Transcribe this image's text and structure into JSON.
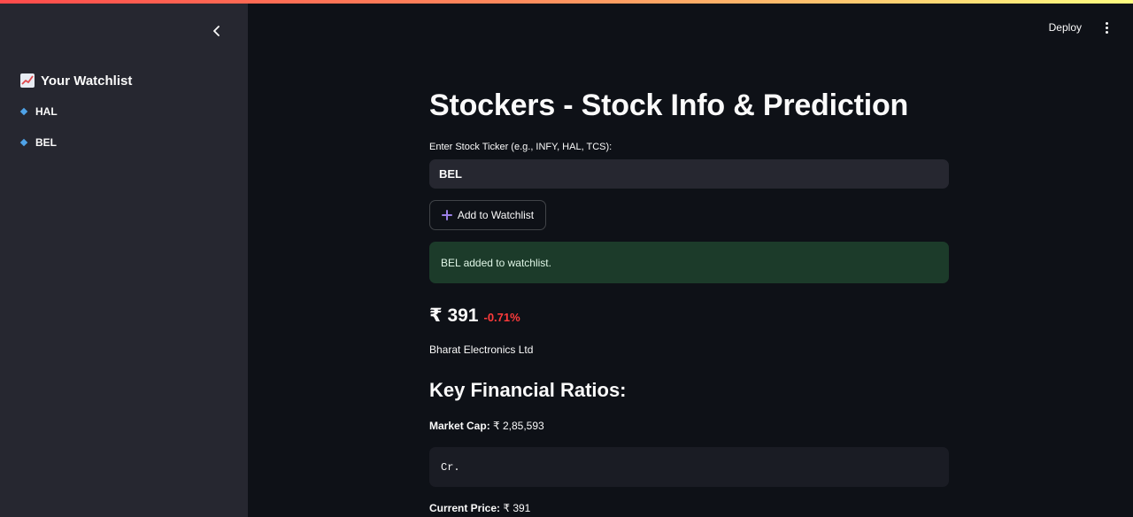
{
  "sidebar": {
    "collapse_icon": "chevron-left-icon",
    "watchlist_title": "Your Watchlist",
    "watchlist_icon": "chart-increasing-icon",
    "items": [
      {
        "label": "HAL"
      },
      {
        "label": "BEL"
      }
    ]
  },
  "header": {
    "deploy_label": "Deploy",
    "menu_icon": "kebab-menu-icon"
  },
  "main": {
    "title": "Stockers - Stock Info & Prediction",
    "ticker_label": "Enter Stock Ticker (e.g., INFY, HAL, TCS):",
    "ticker_value": "BEL",
    "add_button_label": "Add to Watchlist",
    "success_message": "BEL added to watchlist.",
    "price": "₹ 391",
    "change": "-0.71%",
    "company_name": "Bharat Electronics Ltd",
    "ratios_heading": "Key Financial Ratios:",
    "market_cap_label": "Market Cap:",
    "market_cap_value": " ₹ 2,85,593",
    "market_cap_unit": "Cr.",
    "current_price_label": "Current Price:",
    "current_price_value": " ₹ 391"
  },
  "colors": {
    "accent_gradient_start": "#ff4b4b",
    "accent_gradient_end": "#fffd80",
    "negative_change": "#ff3b3b",
    "success_bg": "#1c3b2a",
    "sidebar_bg": "#262730",
    "app_bg": "#0e1117"
  }
}
